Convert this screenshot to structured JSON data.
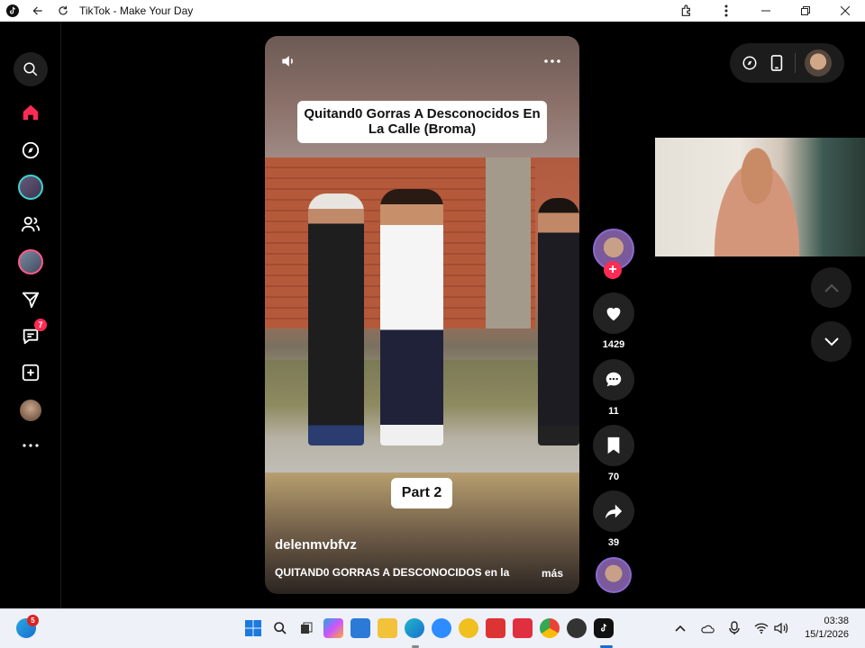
{
  "window": {
    "title": "TikTok - Make Your Day",
    "controls": [
      "minimize",
      "restore",
      "close"
    ]
  },
  "sidebar": {
    "items": [
      {
        "name": "search",
        "icon": "search-icon"
      },
      {
        "name": "home",
        "icon": "home-icon",
        "color": "#fe2c55"
      },
      {
        "name": "explore",
        "icon": "compass-icon"
      },
      {
        "name": "following-live",
        "icon": "avatar"
      },
      {
        "name": "friends",
        "icon": "friends-icon"
      },
      {
        "name": "live",
        "icon": "avatar"
      },
      {
        "name": "messages-send",
        "icon": "paper-plane-icon"
      },
      {
        "name": "inbox",
        "icon": "message-icon",
        "badge": "7"
      },
      {
        "name": "upload",
        "icon": "plus-square-icon"
      },
      {
        "name": "profile",
        "icon": "avatar"
      },
      {
        "name": "more",
        "icon": "more-horizontal-icon"
      }
    ]
  },
  "video": {
    "title_overlay": "Quitand0 Gorras A Desconocidos En La Calle (Broma)",
    "part_label": "Part 2",
    "username": "delenmvbfvz",
    "description": "QUITAND0 GORRAS A DESCONOCIDOS en la",
    "more_label": "más"
  },
  "actions": {
    "likes": "1429",
    "comments": "11",
    "saves": "70",
    "shares": "39"
  },
  "taskbar": {
    "start_badge": "5",
    "time": "03:38",
    "date": "15/1/2026",
    "apps": [
      "windows-start",
      "search",
      "task-view",
      "copilot",
      "store",
      "file-explorer",
      "edge",
      "zoom",
      "app-yellow",
      "app-red",
      "app-w",
      "chrome",
      "app-dark",
      "tiktok"
    ]
  },
  "colors": {
    "accent": "#fe2c55",
    "background": "#000000",
    "taskbar": "#eef1f7"
  }
}
